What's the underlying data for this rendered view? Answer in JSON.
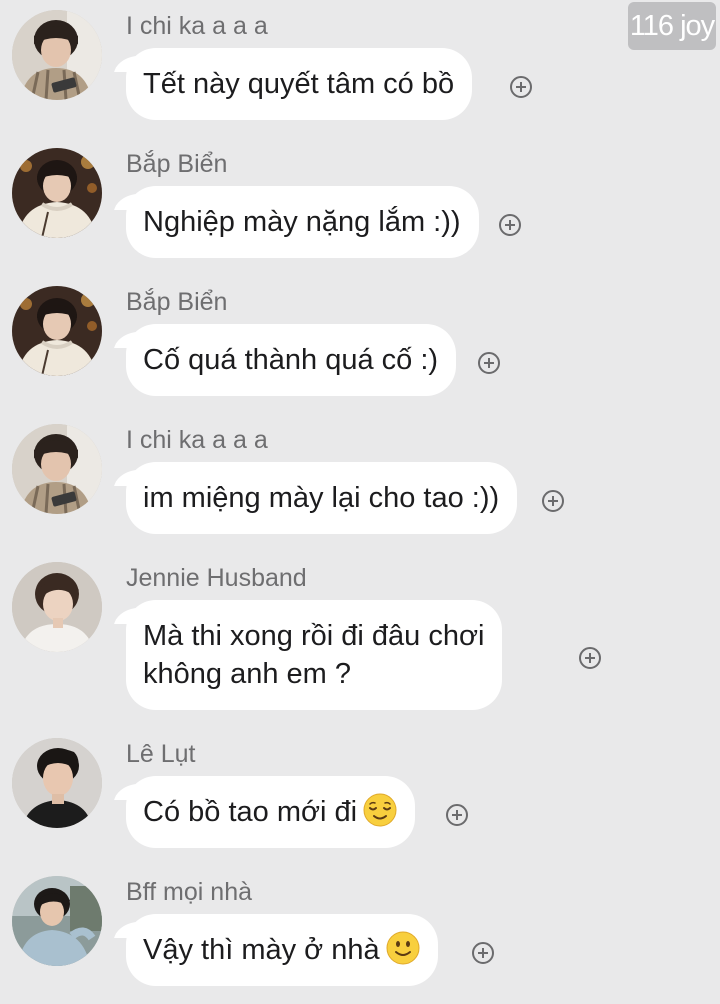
{
  "watermark": "116 joy",
  "reaction_icon": "add-reaction-icon",
  "messages": [
    {
      "sender": "I chi ka a a a",
      "avatar": "avatar-photo-1",
      "text": "Tết này quyết tâm có bồ"
    },
    {
      "sender": "Bắp Biển",
      "avatar": "avatar-photo-2",
      "text": "Nghiệp mày nặng lắm :))"
    },
    {
      "sender": "Bắp Biển",
      "avatar": "avatar-photo-2",
      "text": "Cố quá thành quá cố :)"
    },
    {
      "sender": "I chi ka a a a",
      "avatar": "avatar-photo-1",
      "text": "im miệng mày lại cho tao :))"
    },
    {
      "sender": "Jennie Husband",
      "avatar": "avatar-photo-3",
      "text_lines": [
        "Mà thi xong rồi đi đâu chơi",
        "không anh em ?"
      ]
    },
    {
      "sender": "Lê Lụt",
      "avatar": "avatar-photo-4",
      "text": "Có bồ tao mới đi",
      "emoji": "relieved-face-emoji"
    },
    {
      "sender": "Bff mọi nhà",
      "avatar": "avatar-photo-5",
      "text": "Vậy thì mày ở nhà",
      "emoji": "slightly-smiling-face-emoji"
    }
  ]
}
